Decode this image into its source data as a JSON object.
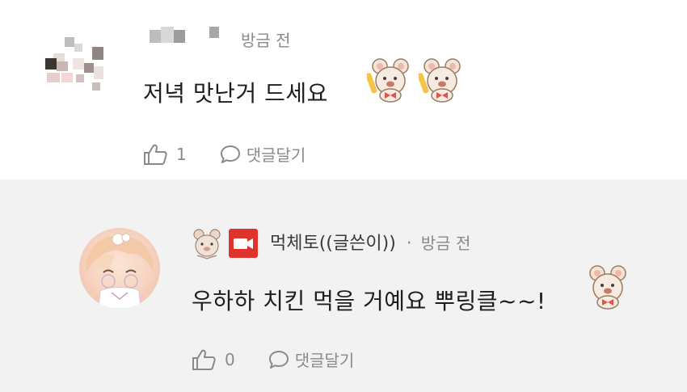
{
  "comment1": {
    "time": "방금 전",
    "text": "저녁 맛난거 드세요",
    "likes": "1",
    "reply_label": "댓글달기",
    "stickers": [
      "bear-sticker",
      "bear-sticker"
    ]
  },
  "comment2": {
    "author": "먹체토((글쓴이))",
    "separator": "·",
    "time": "방금 전",
    "text": "우하하 치킨 먹을 거예요 뿌링클~~!",
    "likes": "0",
    "reply_label": "댓글달기",
    "stickers": [
      "bear-sticker"
    ]
  },
  "colors": {
    "reply_background": "#f2f2f2",
    "writer_badge": "#e0332e",
    "meta_text": "#8a8a8a"
  }
}
